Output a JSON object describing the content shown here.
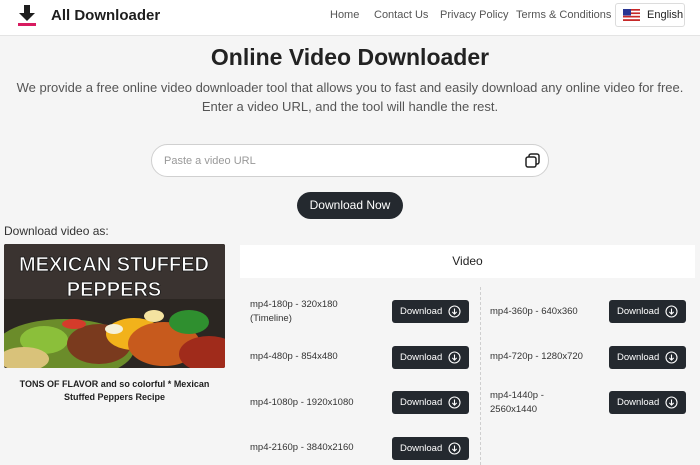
{
  "header": {
    "brand": "All Downloader",
    "nav": [
      "Home",
      "Contact Us",
      "Privacy Policy",
      "Terms & Conditions"
    ],
    "language": "English",
    "logo_icon": "download-arrow-icon",
    "accent_color": "#d81b60"
  },
  "hero": {
    "title": "Online Video Downloader",
    "desc_line1": "We provide a free online video downloader tool that allows you to fast and easily download any online video for free.",
    "desc_line2": "Enter a video URL, and the tool will handle the rest."
  },
  "search": {
    "placeholder": "Paste a video URL",
    "value": "",
    "paste_icon": "paste-icon"
  },
  "download_now": "Download Now",
  "section_label": "Download video as:",
  "video": {
    "thumbnail_text_line1": "MEXICAN STUFFED",
    "thumbnail_text_line2": "PEPPERS",
    "title_line1": "TONS OF FLAVOR and so colorful * Mexican",
    "title_line2": "Stuffed Peppers Recipe"
  },
  "tab_label": "Video",
  "formats": {
    "left": [
      {
        "line1": "mp4-180p - 320x180",
        "line2": "(Timeline)",
        "button": "Download"
      },
      {
        "line1": "mp4-480p - 854x480",
        "line2": "",
        "button": "Download"
      },
      {
        "line1": "mp4-1080p - 1920x1080",
        "line2": "",
        "button": "Download"
      },
      {
        "line1": "mp4-2160p - 3840x2160",
        "line2": "",
        "button": "Download"
      }
    ],
    "right": [
      {
        "line1": "mp4-360p - 640x360",
        "line2": "",
        "button": "Download"
      },
      {
        "line1": "mp4-720p - 1280x720",
        "line2": "",
        "button": "Download"
      },
      {
        "line1": "mp4-1440p -",
        "line2": "2560x1440",
        "button": "Download"
      }
    ]
  },
  "colors": {
    "button_bg": "#24292f",
    "page_bg": "#f5f5f5"
  }
}
